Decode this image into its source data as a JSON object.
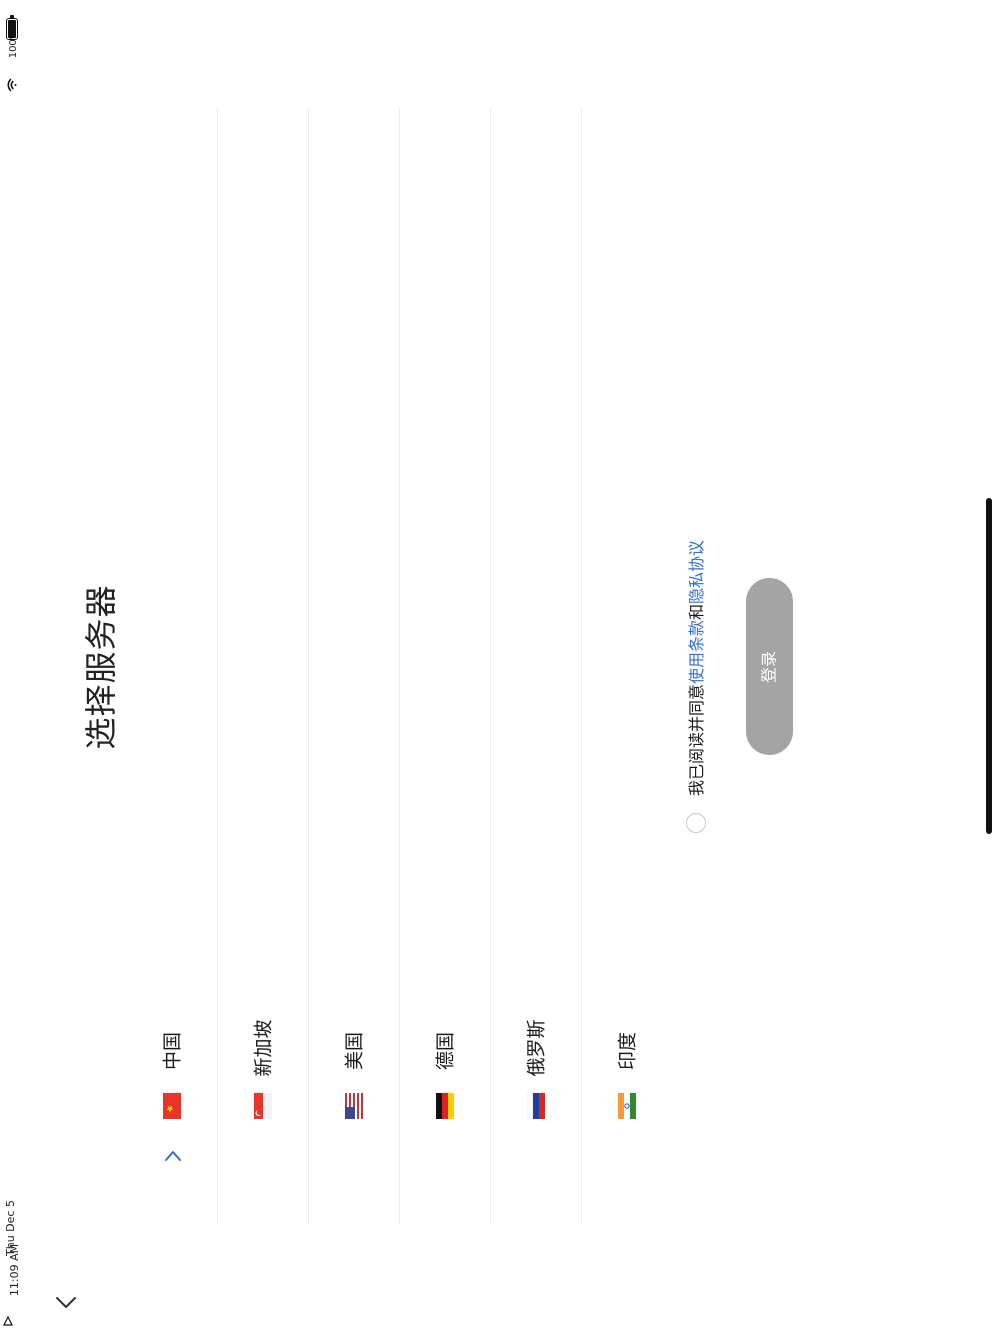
{
  "status_bar": {
    "time": "11:09 AM",
    "date": "Thu Dec 5",
    "battery": "100%"
  },
  "page": {
    "title": "选择服务器"
  },
  "servers": [
    {
      "label": "中国",
      "flag": "china-flag-icon",
      "selected": true
    },
    {
      "label": "新加坡",
      "flag": "singapore-flag-icon",
      "selected": false
    },
    {
      "label": "美国",
      "flag": "usa-flag-icon",
      "selected": false
    },
    {
      "label": "德国",
      "flag": "germany-flag-icon",
      "selected": false
    },
    {
      "label": "俄罗斯",
      "flag": "russia-flag-icon",
      "selected": false
    },
    {
      "label": "印度",
      "flag": "india-flag-icon",
      "selected": false
    }
  ],
  "agreement": {
    "prefix": "我已阅读并同意",
    "terms_link": "使用条款",
    "conjunction": "和",
    "privacy_link": "隐私协议",
    "checked": false
  },
  "login": {
    "label": "登录"
  },
  "colors": {
    "accent": "#2f6fd0",
    "button_disabled": "#a4a4a4",
    "divider": "#ececec"
  }
}
